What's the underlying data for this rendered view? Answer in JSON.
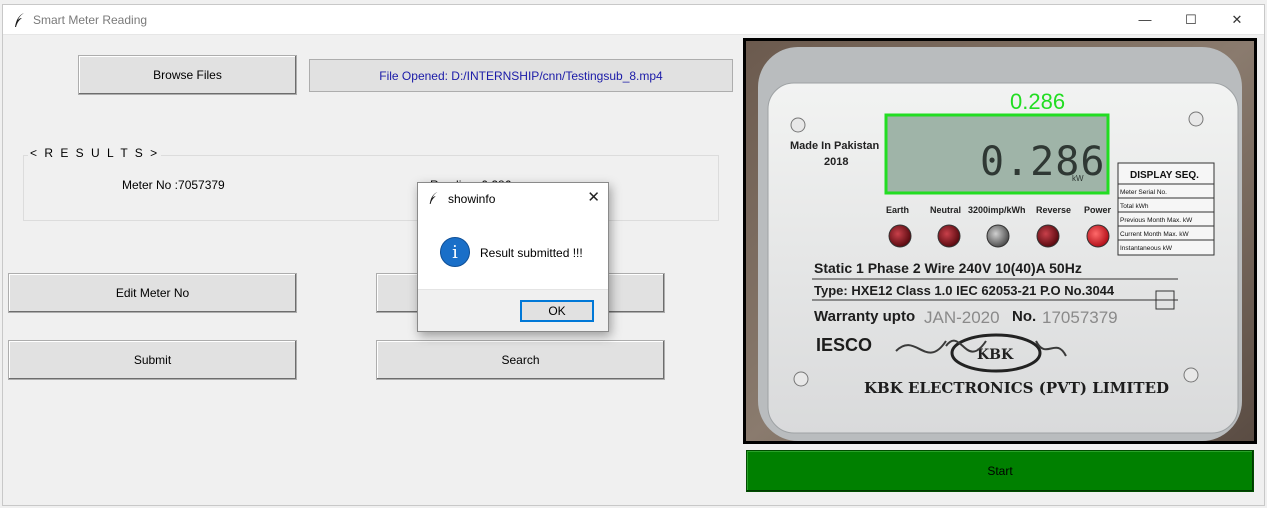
{
  "window": {
    "title": "Smart Meter Reading",
    "minimize": "—",
    "maximize": "☐",
    "close": "✕"
  },
  "toolbar": {
    "browse_label": "Browse Files",
    "file_opened": "File Opened: D:/INTERNSHIP/cnn/Testingsub_8.mp4"
  },
  "results": {
    "legend": "< R E S U L T S >",
    "meter_no": "Meter No :7057379",
    "reading_partial": "Reading: 0.286"
  },
  "buttons": {
    "edit_meter": "Edit Meter No",
    "submit": "Submit",
    "search": "Search",
    "start": "Start"
  },
  "video": {
    "detected_value": "0.286",
    "lcd_value": "0.286",
    "lcd_unit": "kW",
    "made_in": "Made In Pakistan",
    "year": "2018",
    "display_seq_title": "DISPLAY SEQ.",
    "display_seq_items": [
      "Meter Serial No.",
      "Total kWh",
      "Previous Month Max. kW",
      "Current Month Max. kW",
      "Instantaneous kW"
    ],
    "led_labels": [
      "Earth",
      "Neutral",
      "3200imp/kWh",
      "Reverse",
      "Power"
    ],
    "spec_line1": "Static  1 Phase  2 Wire  240V  10(40)A  50Hz",
    "spec_line2": "Type: HXE12  Class 1.0   IEC 62053-21  P.O No.3044",
    "warranty": "Warranty upto",
    "warranty_date": "JAN-2020",
    "serial_label": "No.",
    "serial_value": "17057379",
    "brand_left": "IESCO",
    "brand_logo": "KBK",
    "manufacturer": "KBK ELECTRONICS (PVT) LIMITED",
    "colors": {
      "detection_box": "#22dd22",
      "lcd": "#9fb4a8",
      "led_red": "#8b0d16",
      "led_power": "#e11a22"
    }
  },
  "dialog": {
    "title": "showinfo",
    "close": "✕",
    "message": "Result submitted !!!",
    "icon": "info-icon",
    "ok": "OK"
  }
}
